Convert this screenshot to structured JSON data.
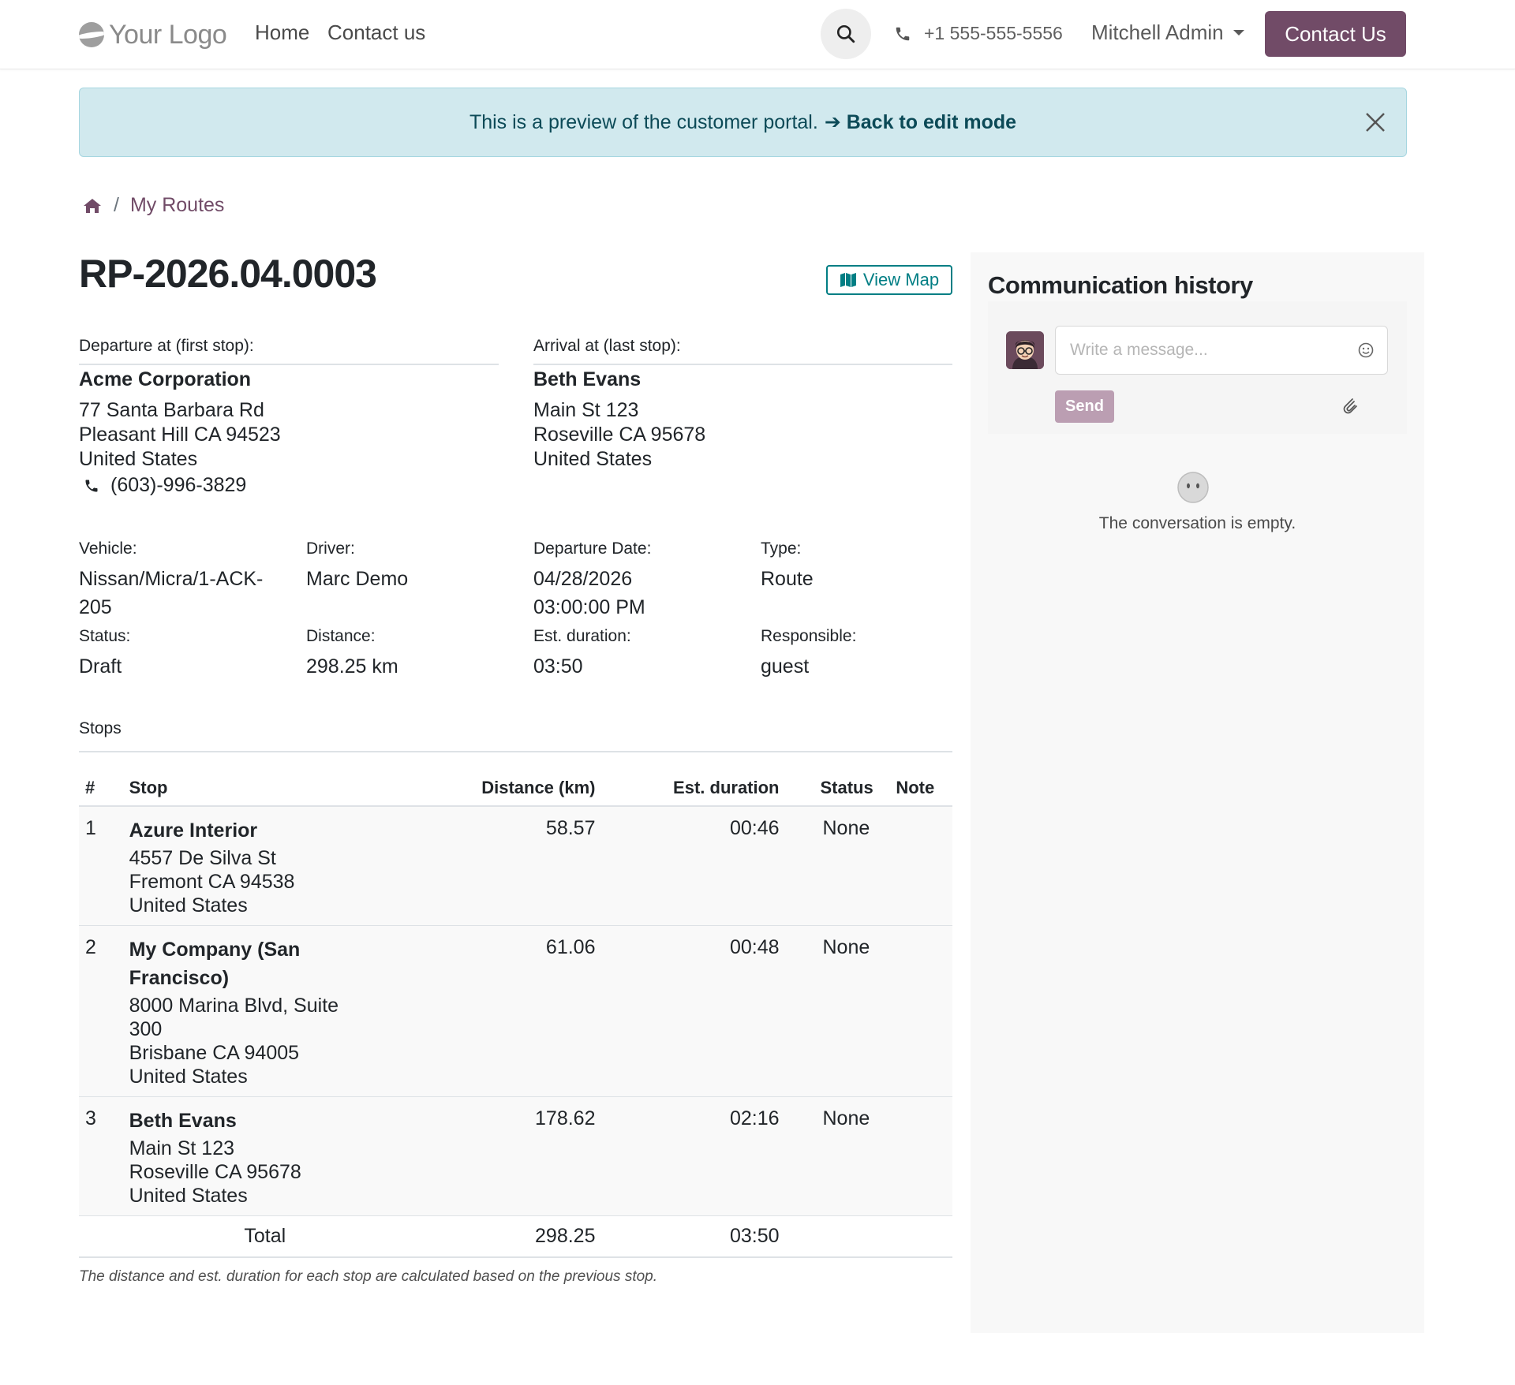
{
  "header": {
    "logo_text": "Your Logo",
    "nav": {
      "home": "Home",
      "contact": "Contact us"
    },
    "phone": "+1 555-555-5556",
    "user": "Mitchell Admin",
    "cta": "Contact Us"
  },
  "alert": {
    "text": "This is a preview of the customer portal.",
    "link": "➔ Back to edit mode"
  },
  "breadcrumb": {
    "current": "My Routes"
  },
  "record": {
    "title": "RP-2026.04.0003",
    "view_map": "View Map"
  },
  "departure": {
    "label": "Departure at (first stop):",
    "name": "Acme Corporation",
    "street": "77 Santa Barbara Rd",
    "city": "Pleasant Hill CA 94523",
    "country": "United States",
    "phone": "(603)-996-3829"
  },
  "arrival": {
    "label": "Arrival at (last stop):",
    "name": "Beth Evans",
    "street": "Main St 123",
    "city": "Roseville CA 95678",
    "country": "United States"
  },
  "fields": {
    "vehicle": {
      "label": "Vehicle:",
      "value": "Nissan/Micra/1-ACK-205"
    },
    "driver": {
      "label": "Driver:",
      "value": "Marc Demo"
    },
    "departure_date": {
      "label": "Departure Date:",
      "value_date": "04/28/2026",
      "value_time": "03:00:00 PM"
    },
    "type": {
      "label": "Type:",
      "value": "Route"
    },
    "status": {
      "label": "Status:",
      "value": "Draft"
    },
    "distance": {
      "label": "Distance:",
      "value": "298.25 km"
    },
    "est_duration": {
      "label": "Est. duration:",
      "value": "03:50"
    },
    "responsible": {
      "label": "Responsible:",
      "value": "guest"
    }
  },
  "stops": {
    "title": "Stops",
    "columns": {
      "num": "#",
      "stop": "Stop",
      "distance": "Distance (km)",
      "duration": "Est. duration",
      "status": "Status",
      "note": "Note"
    },
    "rows": [
      {
        "num": "1",
        "name": "Azure Interior",
        "address": [
          "4557 De Silva St",
          "Fremont CA 94538",
          "United States"
        ],
        "distance": "58.57",
        "duration": "00:46",
        "status": "None",
        "note": ""
      },
      {
        "num": "2",
        "name": "My Company (San Francisco)",
        "address": [
          "8000 Marina Blvd, Suite 300",
          "Brisbane CA 94005",
          "United States"
        ],
        "distance": "61.06",
        "duration": "00:48",
        "status": "None",
        "note": ""
      },
      {
        "num": "3",
        "name": "Beth Evans",
        "address": [
          "Main St 123",
          "Roseville CA 95678",
          "United States"
        ],
        "distance": "178.62",
        "duration": "02:16",
        "status": "None",
        "note": ""
      }
    ],
    "total": {
      "label": "Total",
      "distance": "298.25",
      "duration": "03:50"
    },
    "footnote": "The distance and est. duration for each stop are calculated based on the previous stop."
  },
  "chatter": {
    "title": "Communication history",
    "placeholder": "Write a message...",
    "send": "Send",
    "empty": "The conversation is empty."
  }
}
